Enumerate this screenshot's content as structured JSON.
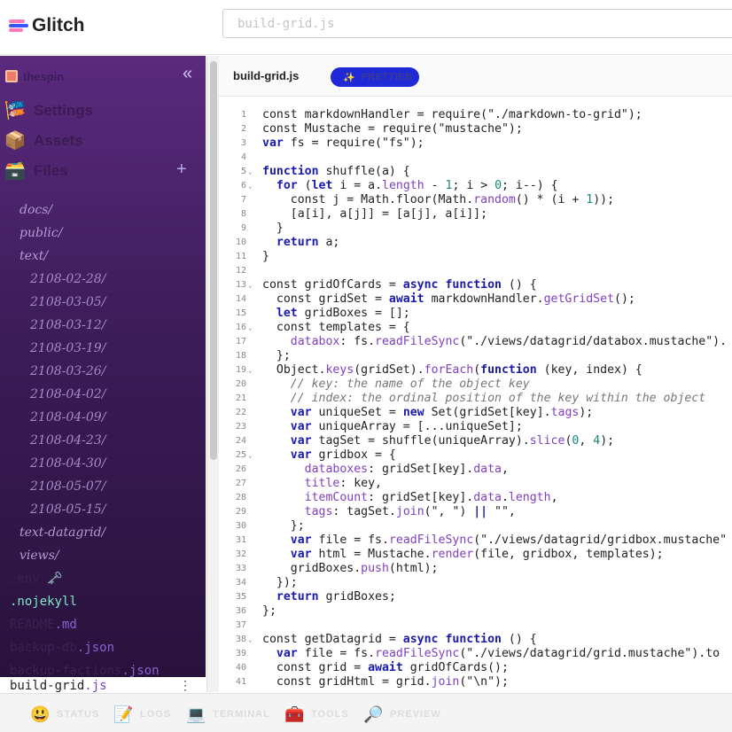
{
  "header": {
    "brand": "Glitch",
    "search_placeholder": "build-grid.js"
  },
  "sidebar": {
    "project_name": "thespin",
    "collapse_glyph": "«",
    "menu": [
      {
        "label": "Settings",
        "icon": "🎏"
      },
      {
        "label": "Assets",
        "icon": "📦"
      },
      {
        "label": "Files",
        "icon": "🗃️"
      }
    ],
    "add_glyph": "+",
    "tree": [
      "docs/",
      "public/",
      "text/",
      "2108-02-28/",
      "2108-03-05/",
      "2108-03-12/",
      "2108-03-19/",
      "2108-03-26/",
      "2108-04-02/",
      "2108-04-09/",
      "2108-04-23/",
      "2108-04-30/",
      "2108-05-07/",
      "2108-05-15/",
      "text-datagrid/",
      "views/"
    ],
    "files": [
      {
        "base": ".env",
        "ext": " 🗝️"
      },
      {
        "base": ".nojekyll",
        "ext": ""
      },
      {
        "base": "README",
        "ext": ".md"
      },
      {
        "base": "backup-db",
        "ext": ".json"
      },
      {
        "base": "backup-factions",
        "ext": ".json"
      }
    ],
    "active_file": {
      "base": "build-grid",
      "ext": ".js",
      "menu": "⋮"
    }
  },
  "editor": {
    "tab_name": "build-grid.js",
    "prettier_label": "PRETTIER",
    "prettier_icon": "✨",
    "lines": [
      {
        "n": "1",
        "fold": false,
        "code": "const markdownHandler = require(\"./markdown-to-grid\");"
      },
      {
        "n": "2",
        "fold": false,
        "code": "const Mustache = require(\"mustache\");"
      },
      {
        "n": "3",
        "fold": false,
        "code": "var fs = require(\"fs\");"
      },
      {
        "n": "4",
        "fold": false,
        "code": ""
      },
      {
        "n": "5",
        "fold": true,
        "code": "function shuffle(a) {"
      },
      {
        "n": "6",
        "fold": true,
        "code": "  for (let i = a.length - 1; i > 0; i--) {"
      },
      {
        "n": "7",
        "fold": false,
        "code": "    const j = Math.floor(Math.random() * (i + 1));"
      },
      {
        "n": "8",
        "fold": false,
        "code": "    [a[i], a[j]] = [a[j], a[i]];"
      },
      {
        "n": "9",
        "fold": false,
        "code": "  }"
      },
      {
        "n": "10",
        "fold": false,
        "code": "  return a;"
      },
      {
        "n": "11",
        "fold": false,
        "code": "}"
      },
      {
        "n": "12",
        "fold": false,
        "code": ""
      },
      {
        "n": "13",
        "fold": true,
        "code": "const gridOfCards = async function () {"
      },
      {
        "n": "14",
        "fold": false,
        "code": "  const gridSet = await markdownHandler.getGridSet();"
      },
      {
        "n": "15",
        "fold": false,
        "code": "  let gridBoxes = [];"
      },
      {
        "n": "16",
        "fold": true,
        "code": "  const templates = {"
      },
      {
        "n": "17",
        "fold": false,
        "code": "    databox: fs.readFileSync(\"./views/datagrid/databox.mustache\")."
      },
      {
        "n": "18",
        "fold": false,
        "code": "  };"
      },
      {
        "n": "19",
        "fold": true,
        "code": "  Object.keys(gridSet).forEach(function (key, index) {"
      },
      {
        "n": "20",
        "fold": false,
        "code": "    // key: the name of the object key"
      },
      {
        "n": "21",
        "fold": false,
        "code": "    // index: the ordinal position of the key within the object"
      },
      {
        "n": "22",
        "fold": false,
        "code": "    var uniqueSet = new Set(gridSet[key].tags);"
      },
      {
        "n": "23",
        "fold": false,
        "code": "    var uniqueArray = [...uniqueSet];"
      },
      {
        "n": "24",
        "fold": false,
        "code": "    var tagSet = shuffle(uniqueArray).slice(0, 4);"
      },
      {
        "n": "25",
        "fold": true,
        "code": "    var gridbox = {"
      },
      {
        "n": "26",
        "fold": false,
        "code": "      databoxes: gridSet[key].data,"
      },
      {
        "n": "27",
        "fold": false,
        "code": "      title: key,"
      },
      {
        "n": "28",
        "fold": false,
        "code": "      itemCount: gridSet[key].data.length,"
      },
      {
        "n": "29",
        "fold": false,
        "code": "      tags: tagSet.join(\", \") || \"\","
      },
      {
        "n": "30",
        "fold": false,
        "code": "    };"
      },
      {
        "n": "31",
        "fold": false,
        "code": "    var file = fs.readFileSync(\"./views/datagrid/gridbox.mustache\""
      },
      {
        "n": "32",
        "fold": false,
        "code": "    var html = Mustache.render(file, gridbox, templates);"
      },
      {
        "n": "33",
        "fold": false,
        "code": "    gridBoxes.push(html);"
      },
      {
        "n": "34",
        "fold": false,
        "code": "  });"
      },
      {
        "n": "35",
        "fold": false,
        "code": "  return gridBoxes;"
      },
      {
        "n": "36",
        "fold": false,
        "code": "};"
      },
      {
        "n": "37",
        "fold": false,
        "code": ""
      },
      {
        "n": "38",
        "fold": true,
        "code": "const getDatagrid = async function () {"
      },
      {
        "n": "39",
        "fold": false,
        "code": "  var file = fs.readFileSync(\"./views/datagrid/grid.mustache\").to"
      },
      {
        "n": "40",
        "fold": false,
        "code": "  const grid = await gridOfCards();"
      },
      {
        "n": "41",
        "fold": false,
        "code": "  const gridHtml = grid.join(\"\\n\");"
      }
    ]
  },
  "bottombar": {
    "items": [
      {
        "label": "STATUS",
        "icon": "😃"
      },
      {
        "label": "LOGS",
        "icon": "📝"
      },
      {
        "label": "TERMINAL",
        "icon": "💻"
      },
      {
        "label": "TOOLS",
        "icon": "🧰"
      },
      {
        "label": "PREVIEW",
        "icon": "🔎"
      }
    ]
  },
  "colors": {
    "sidebar_top": "#5a2a7e",
    "sidebar_bottom": "#28123c",
    "accent": "#1f2ad6",
    "keyword": "#1a1ab0",
    "function": "#7f3fbf"
  }
}
